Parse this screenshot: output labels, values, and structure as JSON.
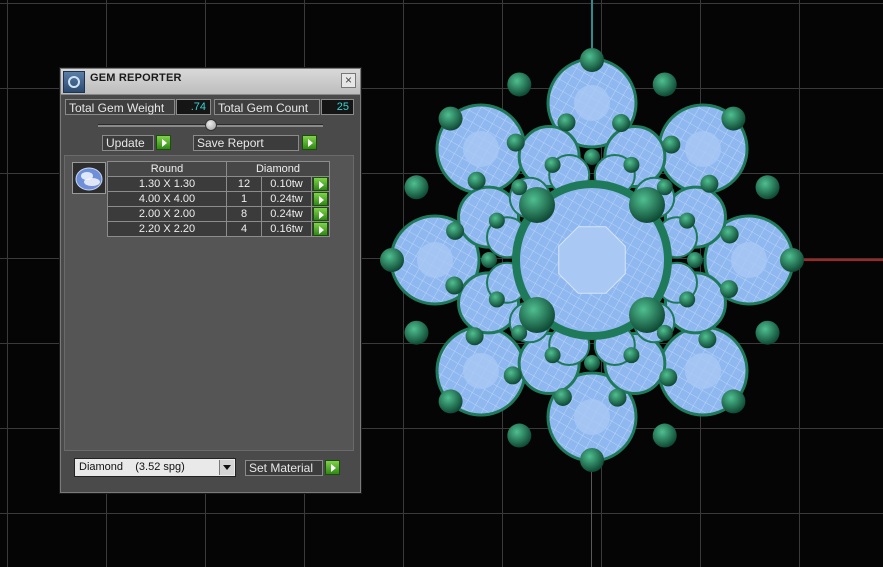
{
  "panel": {
    "title": "GEM REPORTER",
    "close_glyph": "×",
    "total_weight_label": "Total Gem Weight",
    "total_weight_value": ".74",
    "total_count_label": "Total Gem Count",
    "total_count_value": "25",
    "update_label": "Update",
    "save_report_label": "Save Report",
    "table": {
      "headers": [
        "Round",
        "Diamond"
      ],
      "rows": [
        {
          "size": "1.30 X 1.30",
          "count": "12",
          "weight": "0.10tw"
        },
        {
          "size": "4.00 X 4.00",
          "count": "1",
          "weight": "0.24tw"
        },
        {
          "size": "2.00 X 2.00",
          "count": "8",
          "weight": "0.24tw"
        },
        {
          "size": "2.20 X 2.20",
          "count": "4",
          "weight": "0.16tw"
        }
      ]
    },
    "material_select": "Diamond    (3.52 spg)",
    "set_material_label": "Set Material"
  },
  "icons": {
    "app": "gem-reporter-app-icon",
    "gem": "round-gem-icon",
    "go": "green-arrow-icon"
  },
  "colors": {
    "value_text": "#35d4d4",
    "gem_blue": "#8fb8f0",
    "metal_green": "#1f7a5a",
    "axis_red": "#b02020",
    "axis_teal": "#2e8c8c"
  }
}
